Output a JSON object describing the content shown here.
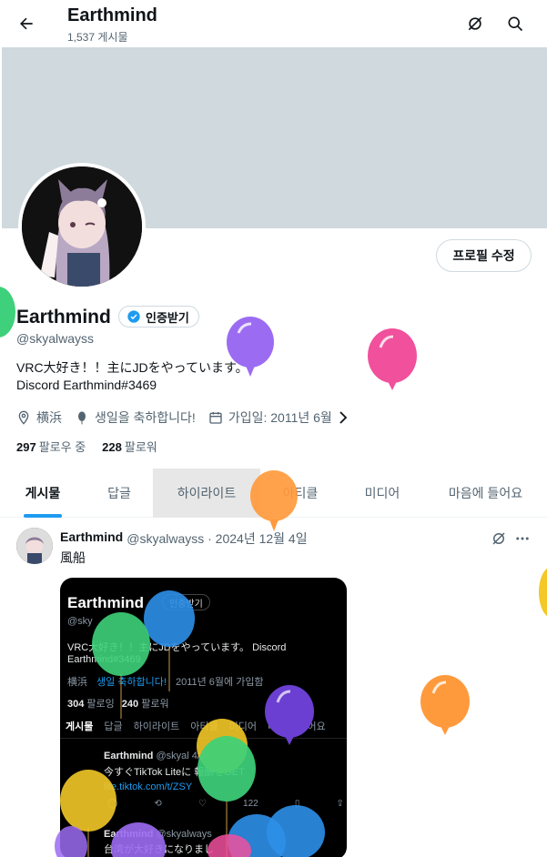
{
  "header": {
    "title": "Earthmind",
    "post_count": "1,537 게시물"
  },
  "profile": {
    "name": "Earthmind",
    "verified_label": "인증받기",
    "handle": "@skyalwayss",
    "bio_line1": "VRC大好き！！主にJDをやっています。",
    "bio_line2": "Discord  Earthmind#3469",
    "location": "横浜",
    "birthday": "생일을 축하합니다!",
    "joined": "가입일: 2011년 6월",
    "following_count": "297",
    "following_label": "팔로우 중",
    "followers_count": "228",
    "followers_label": "팔로워",
    "edit_button": "프로필 수정"
  },
  "tabs": [
    {
      "label": "게시물"
    },
    {
      "label": "답글"
    },
    {
      "label": "하이라이트"
    },
    {
      "label": "아티클"
    },
    {
      "label": "미디어"
    },
    {
      "label": "마음에 들어요"
    }
  ],
  "post": {
    "author": "Earthmind",
    "meta": "@skyalwayss · 2024년 12월 4일",
    "text": "風船",
    "media": {
      "name": "Earthmind",
      "badge": "인증받기",
      "handle": "@sky",
      "bio": "VRC大好き！！主にJDをやっています。 Discord",
      "bio2": "Earthmind#3469",
      "location": "横浜",
      "birthday": "생일 축하합니다!",
      "joined": "2011년 6월에 가입함",
      "following": "304",
      "following_label": "팔로잉",
      "followers": "240",
      "followers_label": "팔로워",
      "tabs": [
        "게시물",
        "답글",
        "하이라이트",
        "아티클",
        "미디어",
        "마음에 들어요"
      ],
      "post_author": "Earthmind",
      "post_handle": "@skyal",
      "post_date": "4/06/16",
      "post_text": "今すぐTikTok Liteに",
      "post_text2": "報酬をGET",
      "post_link": "lite.tiktok.com/t/ZSY",
      "views": "122",
      "post2_author": "Earthmind",
      "post2_handle": "@skyalways",
      "post2_text": "台湾が大好きになりまし"
    }
  },
  "colors": {
    "accent": "#1d9bf0",
    "banner": "#cfd9de",
    "balloon_purple": "#9b6cf2",
    "balloon_pink": "#f0509c",
    "balloon_orange": "#ff9a3c",
    "balloon_blue": "#2d8fe8",
    "balloon_green": "#3ed07a",
    "balloon_yellow": "#f3c827",
    "balloon_indigo": "#6a3fd1"
  }
}
